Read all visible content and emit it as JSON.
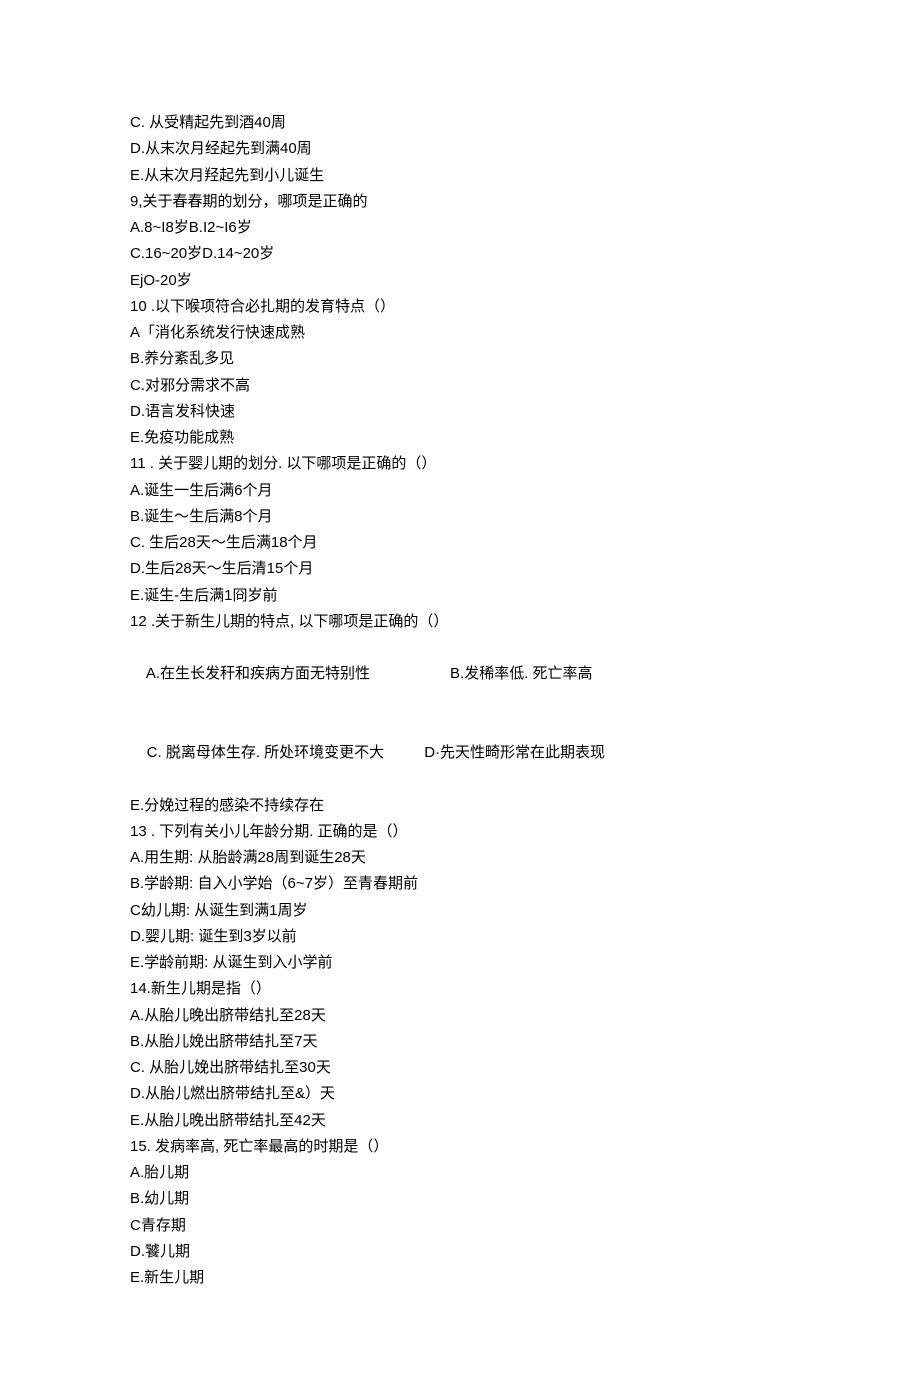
{
  "lines": {
    "l1": "C. 从受精起先到酒40周",
    "l2": "D.从末次月经起先到满40周",
    "l3": "E.从末次月羟起先到小儿诞生",
    "l4": "9,关于春春期的划分，哪项是正确的",
    "l5": "A.8~I8岁B.I2~I6岁",
    "l6": "C.16~20岁D.14~20岁",
    "l7": "EjO-20岁",
    "l8": "10 .以下喉项符合必扎期的发育特点（）",
    "l9": "A「消化系统发行快速成熟",
    "l10": "B.养分紊乱多见",
    "l11": "C.对邪分需求不高",
    "l12": "D.语言发科快速",
    "l13": "E.免疫功能成熟",
    "l14": "11 . 关于婴儿期的划分. 以下哪项是正确的（）",
    "l15": "A.诞生一生后满6个月",
    "l16": "B.诞生〜生后满8个月",
    "l17": "C. 生后28天〜生后满18个月",
    "l18": "D.生后28天〜生后清15个月",
    "l19": "E.诞生-生后满1冏岁前",
    "l20": "12 .关于新生儿期的特点, 以下哪项是正确的（）",
    "l21a": "A.在生长发秆和疾病方面无特别性",
    "l21b": "B.发稀率低. 死亡率高",
    "l22a": "C. 脱离母体生存. 所处环境变更不大",
    "l22b": "D·先天性畸形常在此期表现",
    "l23": "E.分娩过程的感染不持续存在",
    "l24": "13 . 下列有关小儿年龄分期. 正确的是（）",
    "l25": "A.用生期: 从胎龄满28周到诞生28天",
    "l26": "B.学龄期: 自入小学始（6~7岁）至青春期前",
    "l27": "C幼儿期: 从诞生到满1周岁",
    "l28": "D.婴儿期: 诞生到3岁以前",
    "l29": "E.学龄前期: 从诞生到入小学前",
    "l30": "14.新生儿期是指（）",
    "l31": "A.从胎儿晚出脐带结扎至28天",
    "l32": "B.从胎儿娩出脐带结扎至7天",
    "l33": "C. 从胎儿娩出脐带结扎至30天",
    "l34": "D.从胎儿燃出脐带结扎至&）天",
    "l35": "E.从胎儿晚出脐带结扎至42天",
    "l36": "15. 发病率高, 死亡率最高的时期是（）",
    "l37": "A.胎儿期",
    "l38": "B.幼儿期",
    "l39": "C青存期",
    "l40": "D.饕儿期",
    "l41": "E.新生儿期"
  }
}
